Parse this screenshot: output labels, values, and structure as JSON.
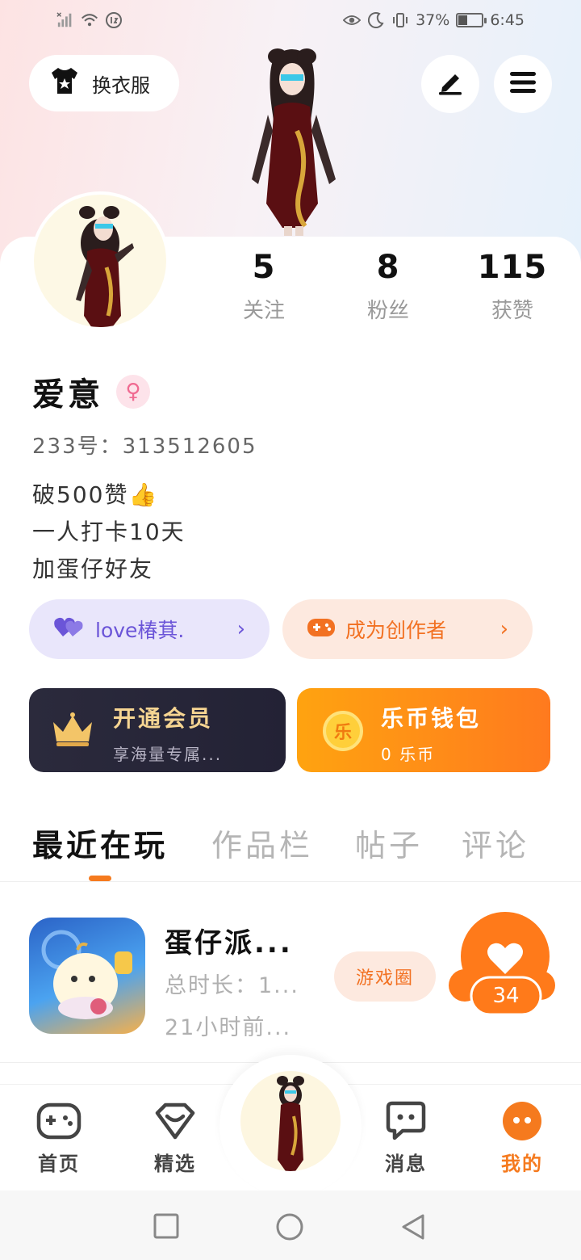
{
  "status_bar": {
    "battery_text": "37%",
    "battery_level": 0.37,
    "time": "6:45"
  },
  "header": {
    "outfit_label": "换衣服",
    "edit_icon": "pen-icon",
    "menu_icon": "menu-icon"
  },
  "stats": [
    {
      "value": "5",
      "label": "关注"
    },
    {
      "value": "8",
      "label": "粉丝"
    },
    {
      "value": "115",
      "label": "获赞"
    }
  ],
  "profile": {
    "nickname": "爱意",
    "gender_symbol": "♀",
    "uid": "233号：313512605",
    "bio_lines": [
      "破500赞👍",
      "一人打卡10天",
      "加蛋仔好友"
    ]
  },
  "pills": {
    "love_label": "love椿萁.",
    "creator_label": "成为创作者",
    "chevron": "›"
  },
  "cards": {
    "vip_title": "开通会员",
    "vip_sub": "享海量专属...",
    "wallet_title": "乐币钱包",
    "wallet_sub": "0 乐币",
    "coin_glyph": "乐"
  },
  "tabs": [
    "最近在玩",
    "作品栏",
    "帖子",
    "评论"
  ],
  "recent_game": {
    "title": "蛋仔派...",
    "playtime": "总时长：1...",
    "last_played": "21小时前...",
    "circle_label": "游戏圈",
    "likes": "34"
  },
  "bottom_nav": [
    {
      "label": "首页",
      "icon": "gamepad-icon"
    },
    {
      "label": "精选",
      "icon": "heart-box-icon"
    },
    {
      "label": "消息",
      "icon": "chat-icon"
    },
    {
      "label": "我的",
      "icon": "profile-dots-icon"
    }
  ],
  "colors": {
    "accent": "#f57a1e",
    "vip_gold": "#f6d592",
    "love_purple": "#6b55d8"
  }
}
